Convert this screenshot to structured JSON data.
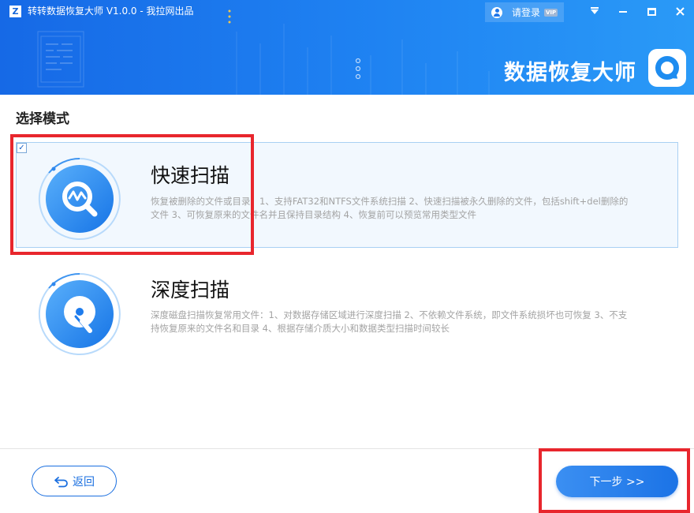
{
  "window": {
    "logo_letter": "Z",
    "title": "转转数据恢复大师 V1.0.0 - 我拉网出品",
    "login_label": "请登录",
    "vip_badge": "VIP",
    "brand_text": "数据恢复大师"
  },
  "section_title": "选择模式",
  "modes": [
    {
      "name": "快速扫描",
      "selected": true,
      "checkmark": "✓",
      "icon": "quick-scan-icon",
      "description": "恢复被删除的文件或目录：1、支持FAT32和NTFS文件系统扫描 2、快速扫描被永久删除的文件，包括shift+del删除的文件 3、可恢复原来的文件名并且保持目录结构 4、恢复前可以预览常用类型文件"
    },
    {
      "name": "深度扫描",
      "selected": false,
      "icon": "deep-scan-icon",
      "description": "深度磁盘扫描恢复常用文件：1、对数据存储区域进行深度扫描 2、不依赖文件系统，即文件系统损坏也可恢复 3、不支持恢复原来的文件名和目录 4、根据存储介质大小和数据类型扫描时间较长"
    }
  ],
  "footer": {
    "back_label": "返回",
    "next_label": "下一步 >>"
  },
  "colors": {
    "header_start": "#1669e6",
    "header_end": "#2a9af7",
    "accent": "#1a6fe0",
    "selected_card_bg": "#f2f8fe",
    "highlight_red": "#e8262d"
  }
}
